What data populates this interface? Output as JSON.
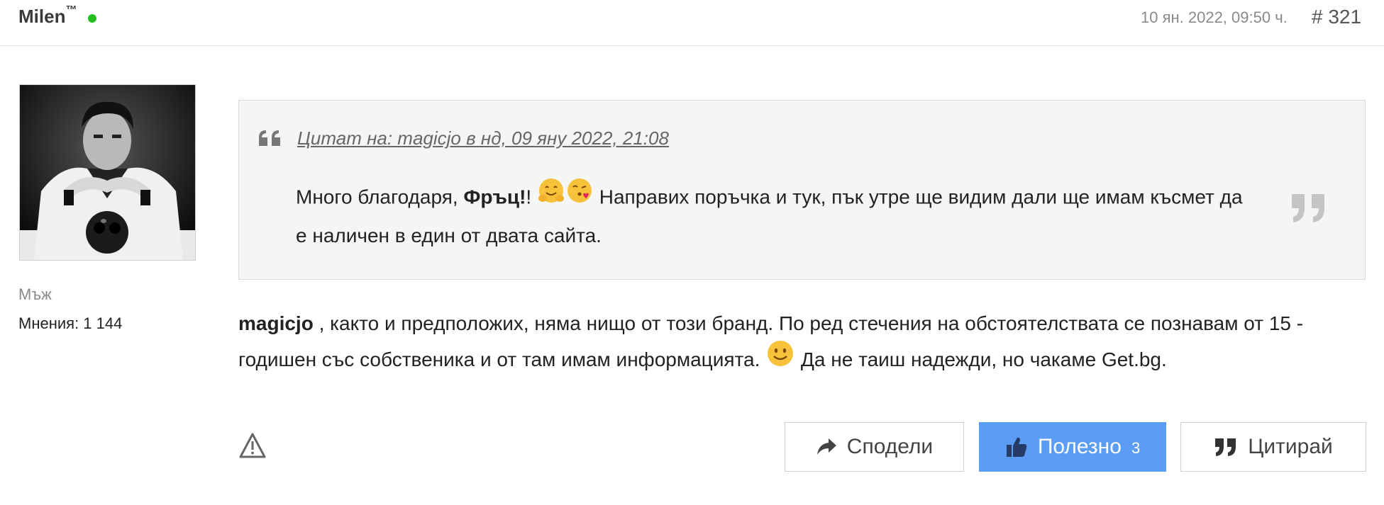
{
  "header": {
    "username": "Milen",
    "username_mark": "™",
    "date": "10 ян. 2022, 09:50 ч.",
    "post_number": "# 321"
  },
  "author": {
    "gender": "Мъж",
    "opinions": "Мнения: 1 144"
  },
  "quote": {
    "cite": "Цитат на: magicjo в нд, 09 яну 2022, 21:08",
    "text_before": "Много благодаря, ",
    "bold_name": "Фръц!",
    "text_exclaim": "! ",
    "text_after": " Направих поръчка и тук, пък утре ще видим дали ще имам късмет да е наличен в един от двата сайта."
  },
  "body": {
    "mention": "magicjo",
    "text_1": " , както и предположих, няма нищо от този бранд. По ред стечения на обстоятелствата се познавам от 15 - годишен със собственика и от там имам информацията. ",
    "text_2": " Да не таиш надежди, но чакаме Get.bg."
  },
  "actions": {
    "share_label": "Сподели",
    "useful_label": "Полезно",
    "useful_count": "3",
    "quote_label": "Цитирай"
  },
  "colors": {
    "online": "#21c01f",
    "useful_button": "#5b9cf5",
    "quote_bg": "#f5f5f5"
  },
  "icons": [
    "online-status-icon",
    "avatar-image",
    "quote-open-icon",
    "quote-close-icon",
    "hugging-face-emoji",
    "kissing-face-emoji",
    "smile-emoji",
    "report-warning-icon",
    "share-arrow-icon",
    "thumbs-up-icon",
    "quote-icon"
  ]
}
